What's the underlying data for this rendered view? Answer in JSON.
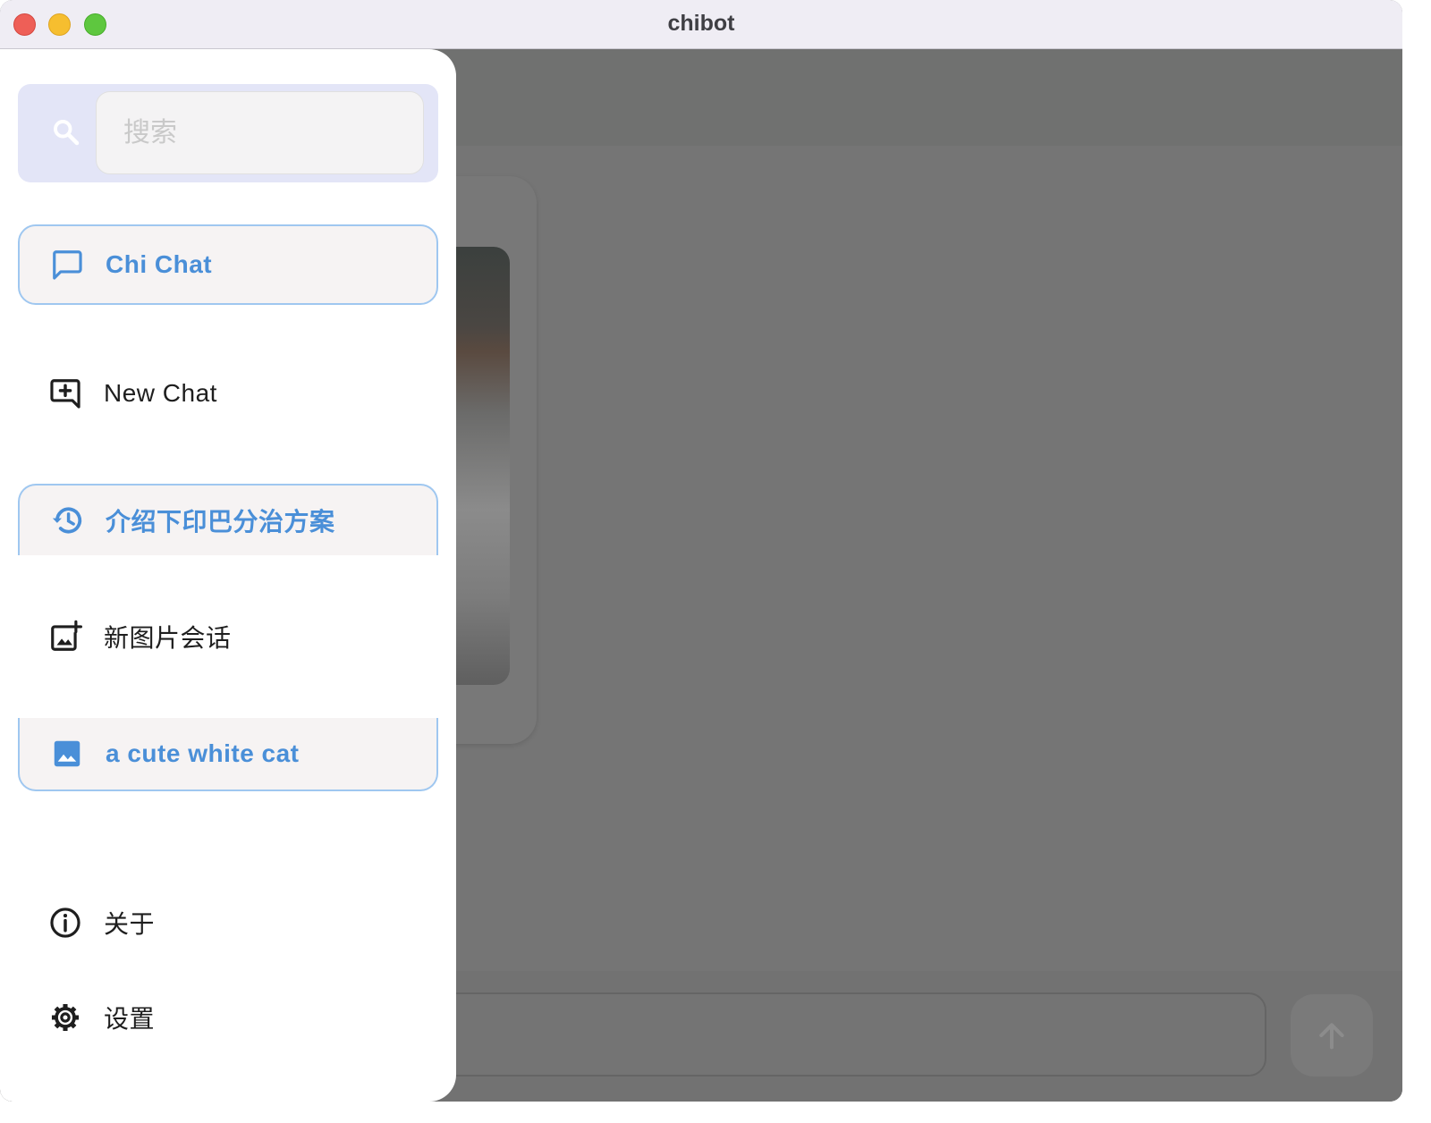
{
  "window": {
    "title": "chibot"
  },
  "search": {
    "placeholder": "搜索",
    "value": ""
  },
  "drawer": {
    "items": [
      {
        "label": "Chi Chat",
        "icon": "chat-bubble-icon",
        "active": true
      },
      {
        "label": "New Chat",
        "icon": "add-comment-icon",
        "active": false
      },
      {
        "label": "介绍下印巴分治方案",
        "icon": "history-icon",
        "active": true
      },
      {
        "label": "新图片会话",
        "icon": "add-photo-icon",
        "active": false
      },
      {
        "label": "a cute white cat",
        "icon": "image-icon",
        "active": true
      },
      {
        "label": "关于",
        "icon": "info-icon",
        "active": false
      },
      {
        "label": "设置",
        "icon": "settings-icon",
        "active": false
      }
    ]
  },
  "colors": {
    "accent": "#4a8fd8",
    "active_border": "#9fc7f0",
    "active_bg": "#f6f3f3",
    "search_bg": "#e3e5f7",
    "scrim": "#757575"
  }
}
